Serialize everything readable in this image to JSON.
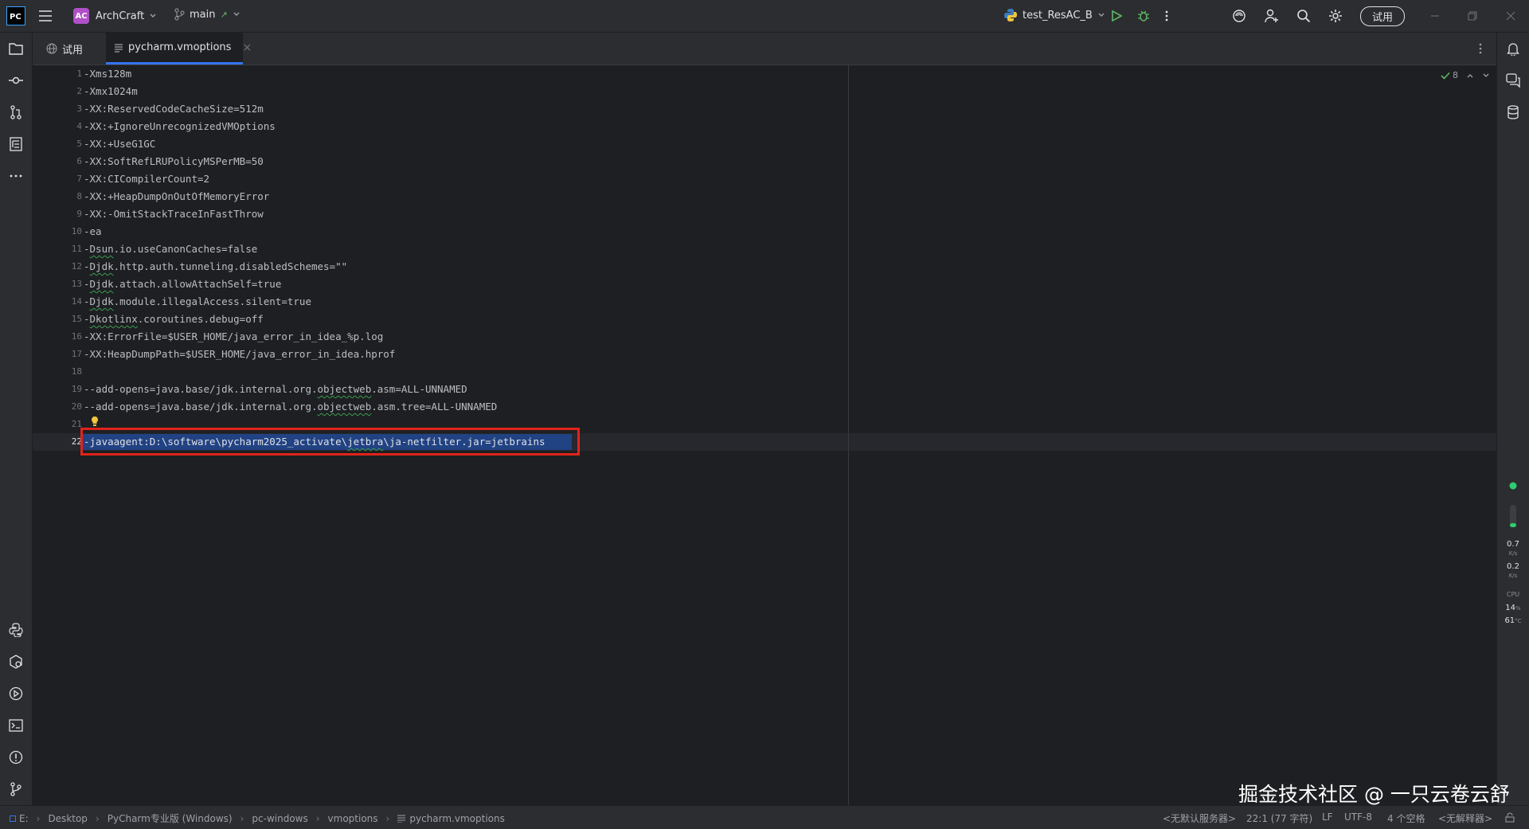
{
  "titlebar": {
    "app_logo": "PC",
    "project_badge": "AC",
    "project_name": "ArchCraft",
    "branch": "main",
    "branch_arrow": "↗",
    "run_config": "test_ResAC_B",
    "trial_button": "试用"
  },
  "tabs": [
    {
      "label": "试用",
      "icon": "globe-icon"
    },
    {
      "label": "pycharm.vmoptions",
      "icon": "file-lines-icon",
      "close": "×"
    }
  ],
  "editor": {
    "lines": [
      {
        "num": "1",
        "text": "-Xms128m"
      },
      {
        "num": "2",
        "text": "-Xmx1024m"
      },
      {
        "num": "3",
        "text": "-XX:ReservedCodeCacheSize=512m"
      },
      {
        "num": "4",
        "text": "-XX:+IgnoreUnrecognizedVMOptions"
      },
      {
        "num": "5",
        "text": "-XX:+UseG1GC"
      },
      {
        "num": "6",
        "text": "-XX:SoftRefLRUPolicyMSPerMB=50"
      },
      {
        "num": "7",
        "text": "-XX:CICompilerCount=2"
      },
      {
        "num": "8",
        "text": "-XX:+HeapDumpOnOutOfMemoryError"
      },
      {
        "num": "9",
        "text": "-XX:-OmitStackTraceInFastThrow"
      },
      {
        "num": "10",
        "text": "-ea"
      },
      {
        "num": "11",
        "pre": "-",
        "squig": "Dsun",
        "post": ".io.useCanonCaches=false"
      },
      {
        "num": "12",
        "pre": "-",
        "squig": "Djdk",
        "post": ".http.auth.tunneling.disabledSchemes=\"\""
      },
      {
        "num": "13",
        "pre": "-",
        "squig": "Djdk",
        "post": ".attach.allowAttachSelf=true"
      },
      {
        "num": "14",
        "pre": "-",
        "squig": "Djdk",
        "post": ".module.illegalAccess.silent=true"
      },
      {
        "num": "15",
        "pre": "-",
        "squig": "Dkotlinx",
        "post": ".coroutines.debug=off"
      },
      {
        "num": "16",
        "text": "-XX:ErrorFile=$USER_HOME/java_error_in_idea_%p.log"
      },
      {
        "num": "17",
        "text": "-XX:HeapDumpPath=$USER_HOME/java_error_in_idea.hprof"
      },
      {
        "num": "18",
        "text": ""
      },
      {
        "num": "19",
        "pre": "--add-opens=java.base/jdk.internal.org.",
        "squig": "objectweb",
        "post": ".asm=ALL-UNNAMED"
      },
      {
        "num": "20",
        "pre": "--add-opens=java.base/jdk.internal.org.",
        "squig": "objectweb",
        "post": ".asm.tree=ALL-UNNAMED"
      },
      {
        "num": "21",
        "text": ""
      },
      {
        "num": "22",
        "pre": "-javaagent:D:\\software\\pycharm2025_activate\\",
        "squig": "jetbra",
        "post": "\\ja-netfilter.jar=jetbrains"
      }
    ],
    "inspection_count": "8"
  },
  "right_stats": {
    "net_up": "0.7",
    "net_down": "0.2",
    "net_unit": "K/s",
    "cpu_label": "CPU",
    "cpu_value": "14",
    "cpu_unit": "%",
    "temp_value": "61",
    "temp_unit": "°C"
  },
  "statusbar": {
    "drive": "E:",
    "breadcrumbs": [
      "Desktop",
      "PyCharm专业版 (Windows)",
      "pc-windows",
      "vmoptions",
      "pycharm.vmoptions"
    ],
    "server": "<无默认服务器>",
    "position": "22:1 (77 字符)",
    "line_sep": "LF",
    "encoding": "UTF-8",
    "indent": "4 个空格",
    "interpreter": "<无解释器>"
  },
  "watermark": "掘金技术社区 @ 一只云卷云舒",
  "colors": {
    "accent": "#3574f0",
    "highlight_box": "#e0241b",
    "selection": "#214283"
  }
}
